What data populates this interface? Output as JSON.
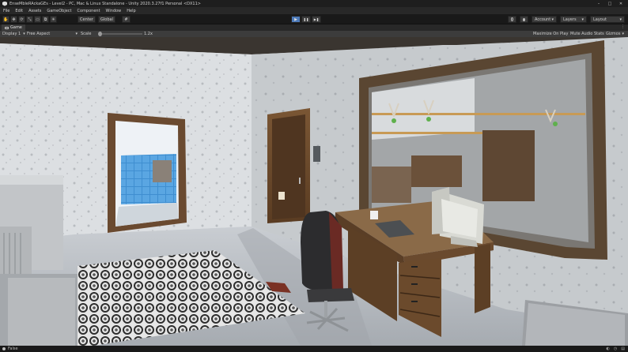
{
  "window": {
    "title": "EnseMbleRAckaGEs - Level2 - PC, Mac & Linux Standalone - Unity 2020.3.27f1 Personal <DX11>",
    "controls": [
      "–",
      "□",
      "✕"
    ]
  },
  "menu": [
    "File",
    "Edit",
    "Assets",
    "GameObject",
    "Component",
    "Window",
    "Help"
  ],
  "toolbar": {
    "tools": [
      "✋",
      "✥",
      "⟳",
      "⤡",
      "▭",
      "⧉",
      "✳"
    ],
    "pivot_label": "Center",
    "space_label": "Global",
    "snap_icon": "#",
    "play_icons": [
      "▶",
      "❚❚",
      "▶❚"
    ],
    "account_label": "Account",
    "layers_label": "Layers",
    "layout_label": "Layout",
    "dropdown_arrow": "▾"
  },
  "game_view": {
    "tab_label": "Game",
    "display_label": "Display 1",
    "aspect_label": "Free Aspect",
    "scale_label": "Scale",
    "scale_value": "1.2x",
    "maximize_label": "Maximize On Play",
    "mute_label": "Mute Audio",
    "stats_label": "Stats",
    "gizmos_label": "Gizmos"
  },
  "status": {
    "message": "False"
  },
  "colors": {
    "play_active": "#4d7ab8",
    "wall": "#d8dadd",
    "wood": "#6b4a2c"
  }
}
